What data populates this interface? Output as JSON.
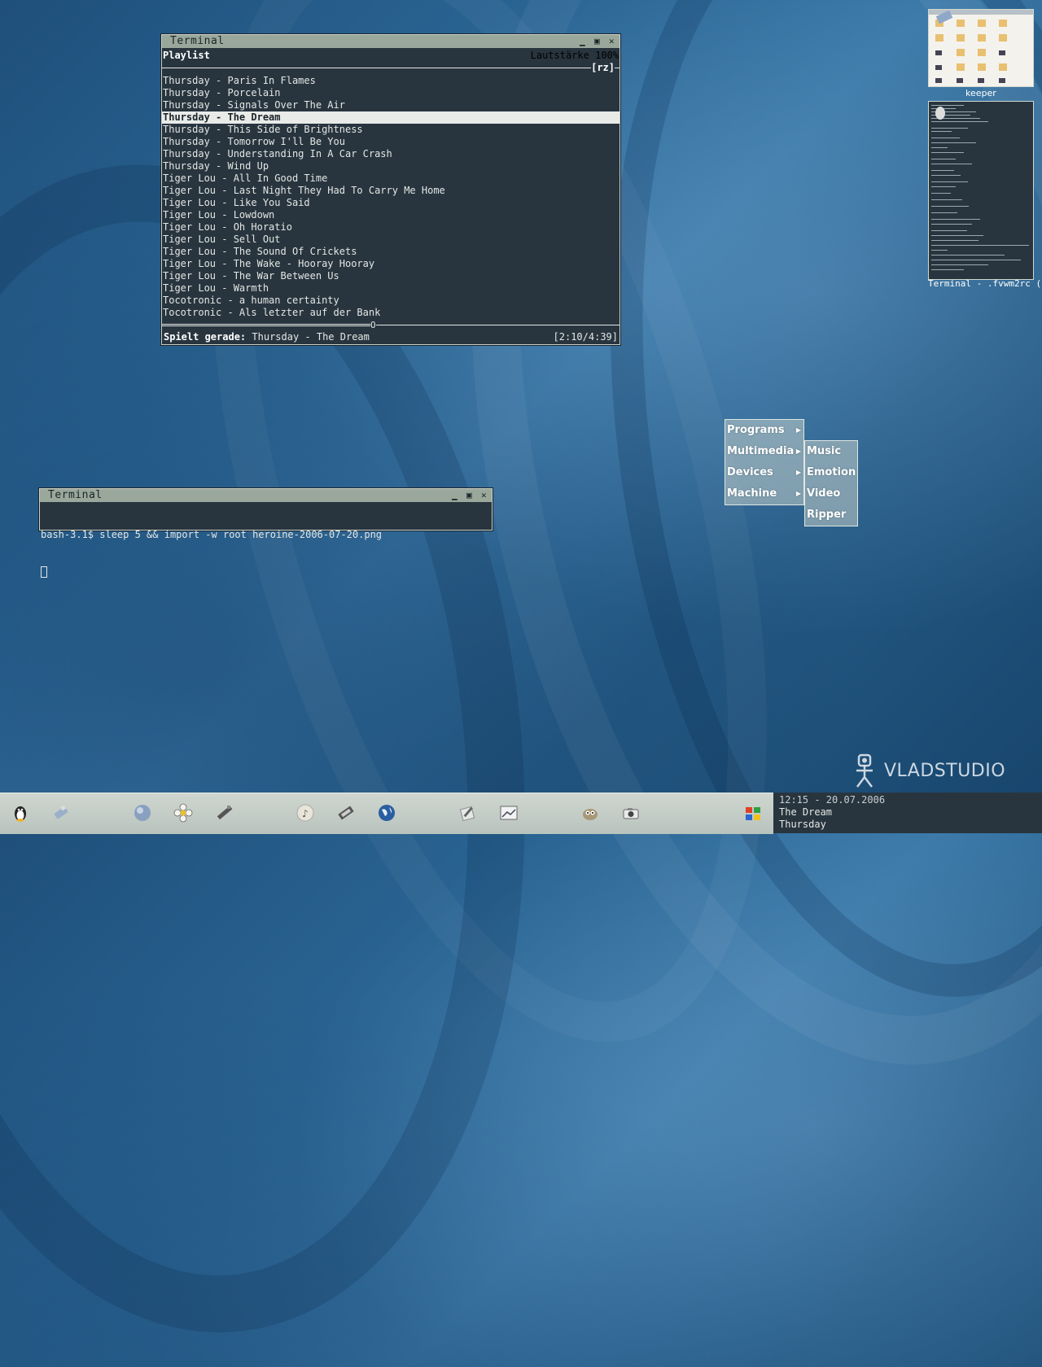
{
  "desktop": {
    "logo_text": "VLADSTUDIO"
  },
  "player_window": {
    "title": "Terminal",
    "header_title": "Playlist",
    "volume": "Lautstärke 100%",
    "top_rule_tag": "[rz]",
    "tracks": [
      "Thursday - Paris In Flames",
      "Thursday - Porcelain",
      "Thursday - Signals Over The Air",
      "Thursday - The Dream",
      "Thursday - This Side of Brightness",
      "Thursday - Tomorrow I'll Be You",
      "Thursday - Understanding In A Car Crash",
      "Thursday - Wind Up",
      "Tiger Lou - All In Good Time",
      "Tiger Lou - Last Night They Had To Carry Me Home",
      "Tiger Lou - Like You Said",
      "Tiger Lou - Lowdown",
      "Tiger Lou - Oh Horatio",
      "Tiger Lou - Sell Out",
      "Tiger Lou - The Sound Of Crickets",
      "Tiger Lou - The Wake - Hooray Hooray",
      "Tiger Lou - The War Between Us",
      "Tiger Lou - Warmth",
      "Tocotronic - a human certainty",
      "Tocotronic - Als letzter auf der Bank"
    ],
    "selected_index": 3,
    "progress_rule": "=================================================================O",
    "now_playing_label": "Spielt gerade:",
    "now_playing_track": "Thursday - The Dream",
    "time": "[2:10/4:39]"
  },
  "shell_window": {
    "title": "Terminal",
    "command_line": "bash-3.1$ sleep 5 && import -w root heroine-2006-07-20.png"
  },
  "root_menu": {
    "items": [
      "Programs",
      "Multimedia",
      "Devices",
      "Machine"
    ]
  },
  "submenu": {
    "items": [
      "Music",
      "Emotion",
      "Video",
      "Ripper"
    ]
  },
  "pager": {
    "thumb1_label": "keeper",
    "thumb2_label": "Terminal - .fvwm2rc ("
  },
  "taskbar": {
    "icons": [
      "tux-icon",
      "usb-stick-icon",
      "globe-icon",
      "flower-icon",
      "tools-icon",
      "music-disc-icon",
      "film-icon",
      "earth-icon",
      "edit-icon",
      "image-icon",
      "gimp-icon",
      "camera-icon",
      "windows-icon"
    ]
  },
  "clock": {
    "datetime": "12:15 - 20.07.2006",
    "track": "The Dream",
    "artist": "Thursday"
  }
}
